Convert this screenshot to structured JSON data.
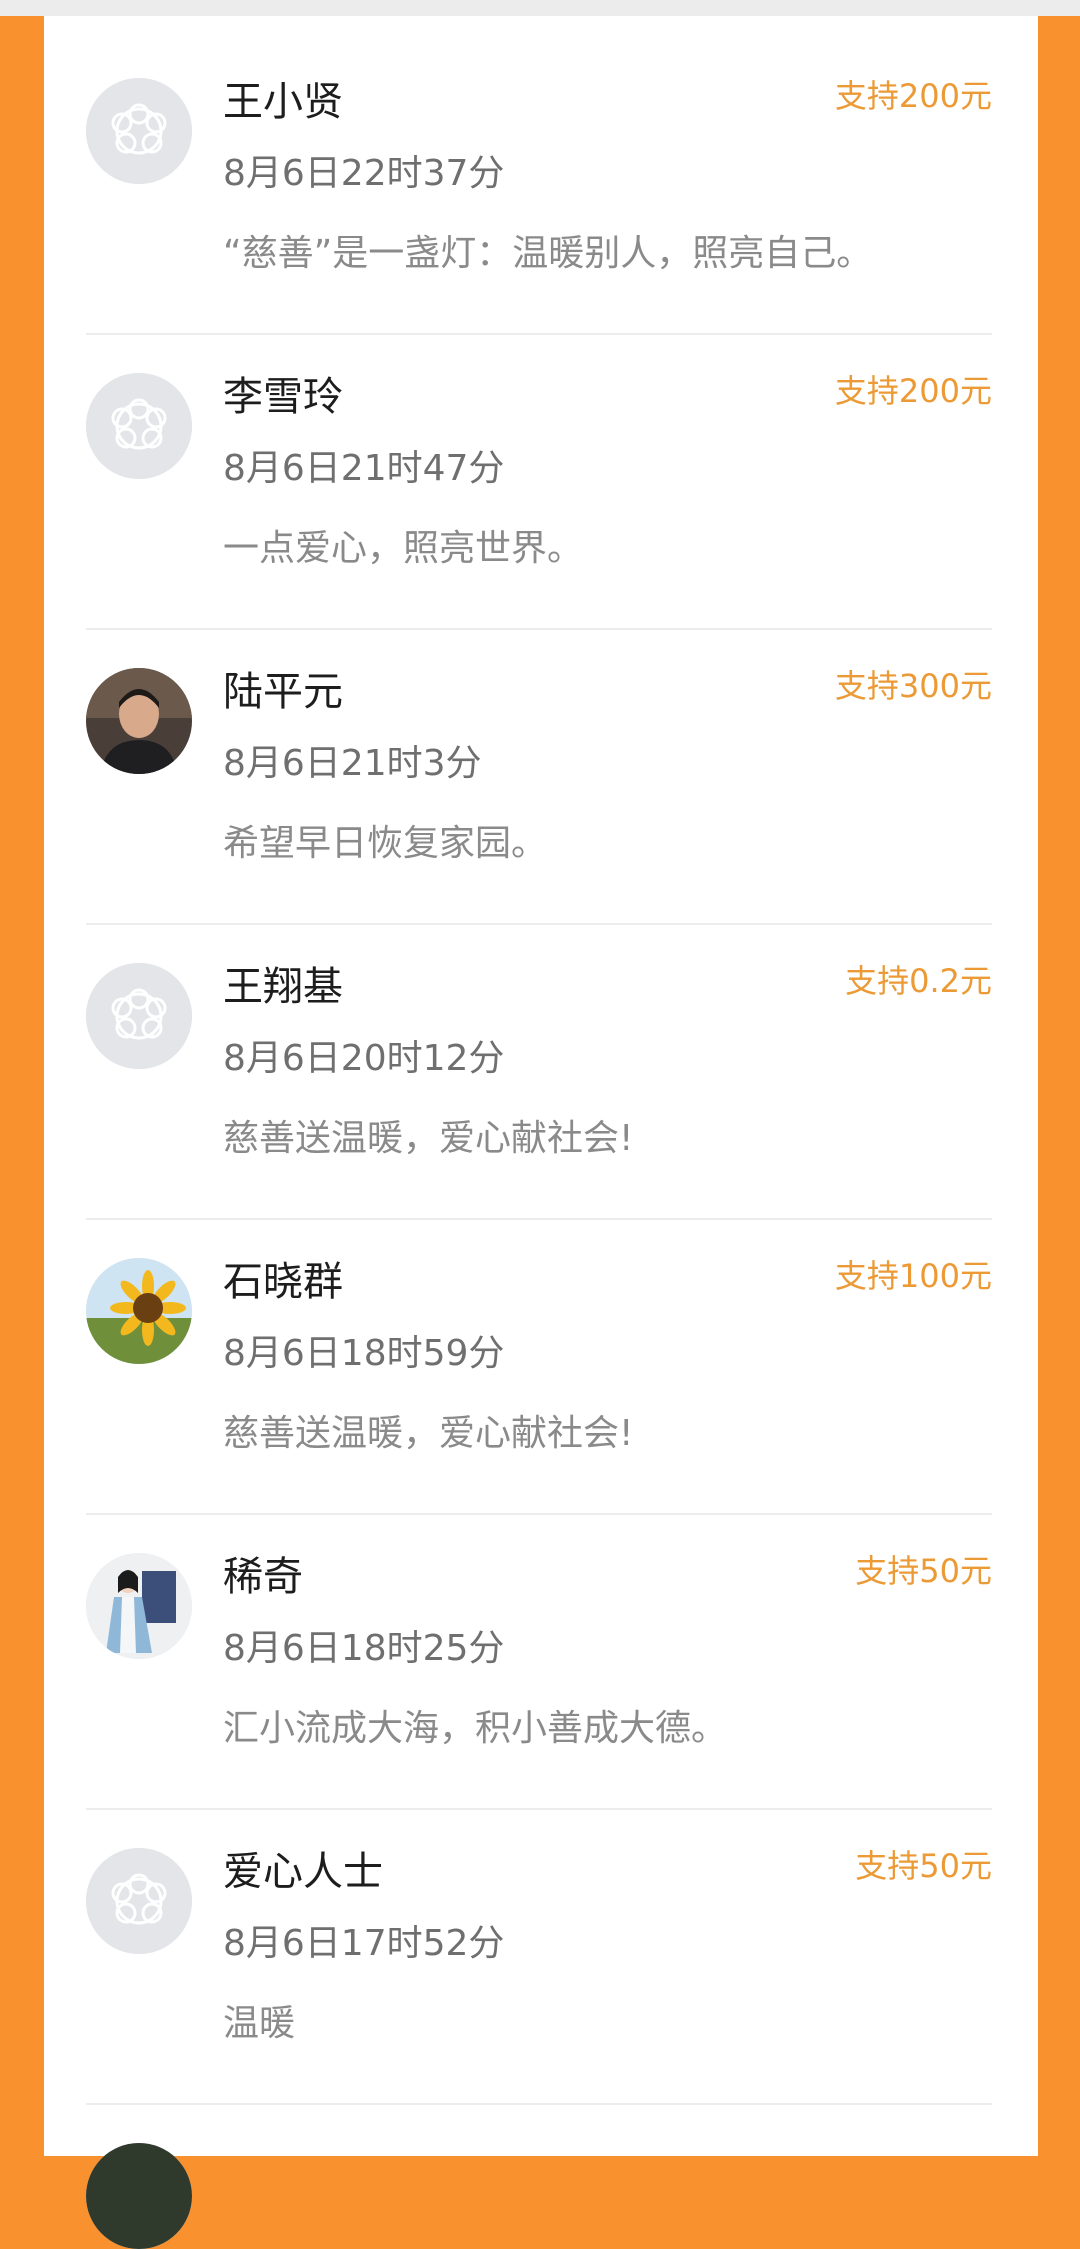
{
  "donations": [
    {
      "name": "王小贤",
      "time": "8月6日22时37分",
      "message": "“慈善”是一盏灯：温暖别人，照亮自己。",
      "amount": "支持200元",
      "avatar": "default-flower-avatar"
    },
    {
      "name": "李雪玲",
      "time": "8月6日21时47分",
      "message": "一点爱心，照亮世界。",
      "amount": "支持200元",
      "avatar": "default-flower-avatar"
    },
    {
      "name": "陆平元",
      "time": "8月6日21时3分",
      "message": "希望早日恢复家园。",
      "amount": "支持300元",
      "avatar": "person-photo-avatar"
    },
    {
      "name": "王翔基",
      "time": "8月6日20时12分",
      "message": "慈善送温暖，爱心献社会!",
      "amount": "支持0.2元",
      "avatar": "default-flower-avatar"
    },
    {
      "name": "石晓群",
      "time": "8月6日18时59分",
      "message": "慈善送温暖，爱心献社会!",
      "amount": "支持100元",
      "avatar": "sunflower-avatar"
    },
    {
      "name": "稀奇",
      "time": "8月6日18时25分",
      "message": "汇小流成大海，积小善成大德。",
      "amount": "支持50元",
      "avatar": "illustrated-figure-avatar"
    },
    {
      "name": "爱心人士",
      "time": "8月6日17时52分",
      "message": "温暖",
      "amount": "支持50元",
      "avatar": "default-flower-avatar"
    }
  ],
  "colors": {
    "background": "#f9912f",
    "panel": "#ffffff",
    "amount": "#eb9a35",
    "name": "#1d1d1d",
    "time": "#6f6f6f",
    "message": "#8a8a8a"
  }
}
